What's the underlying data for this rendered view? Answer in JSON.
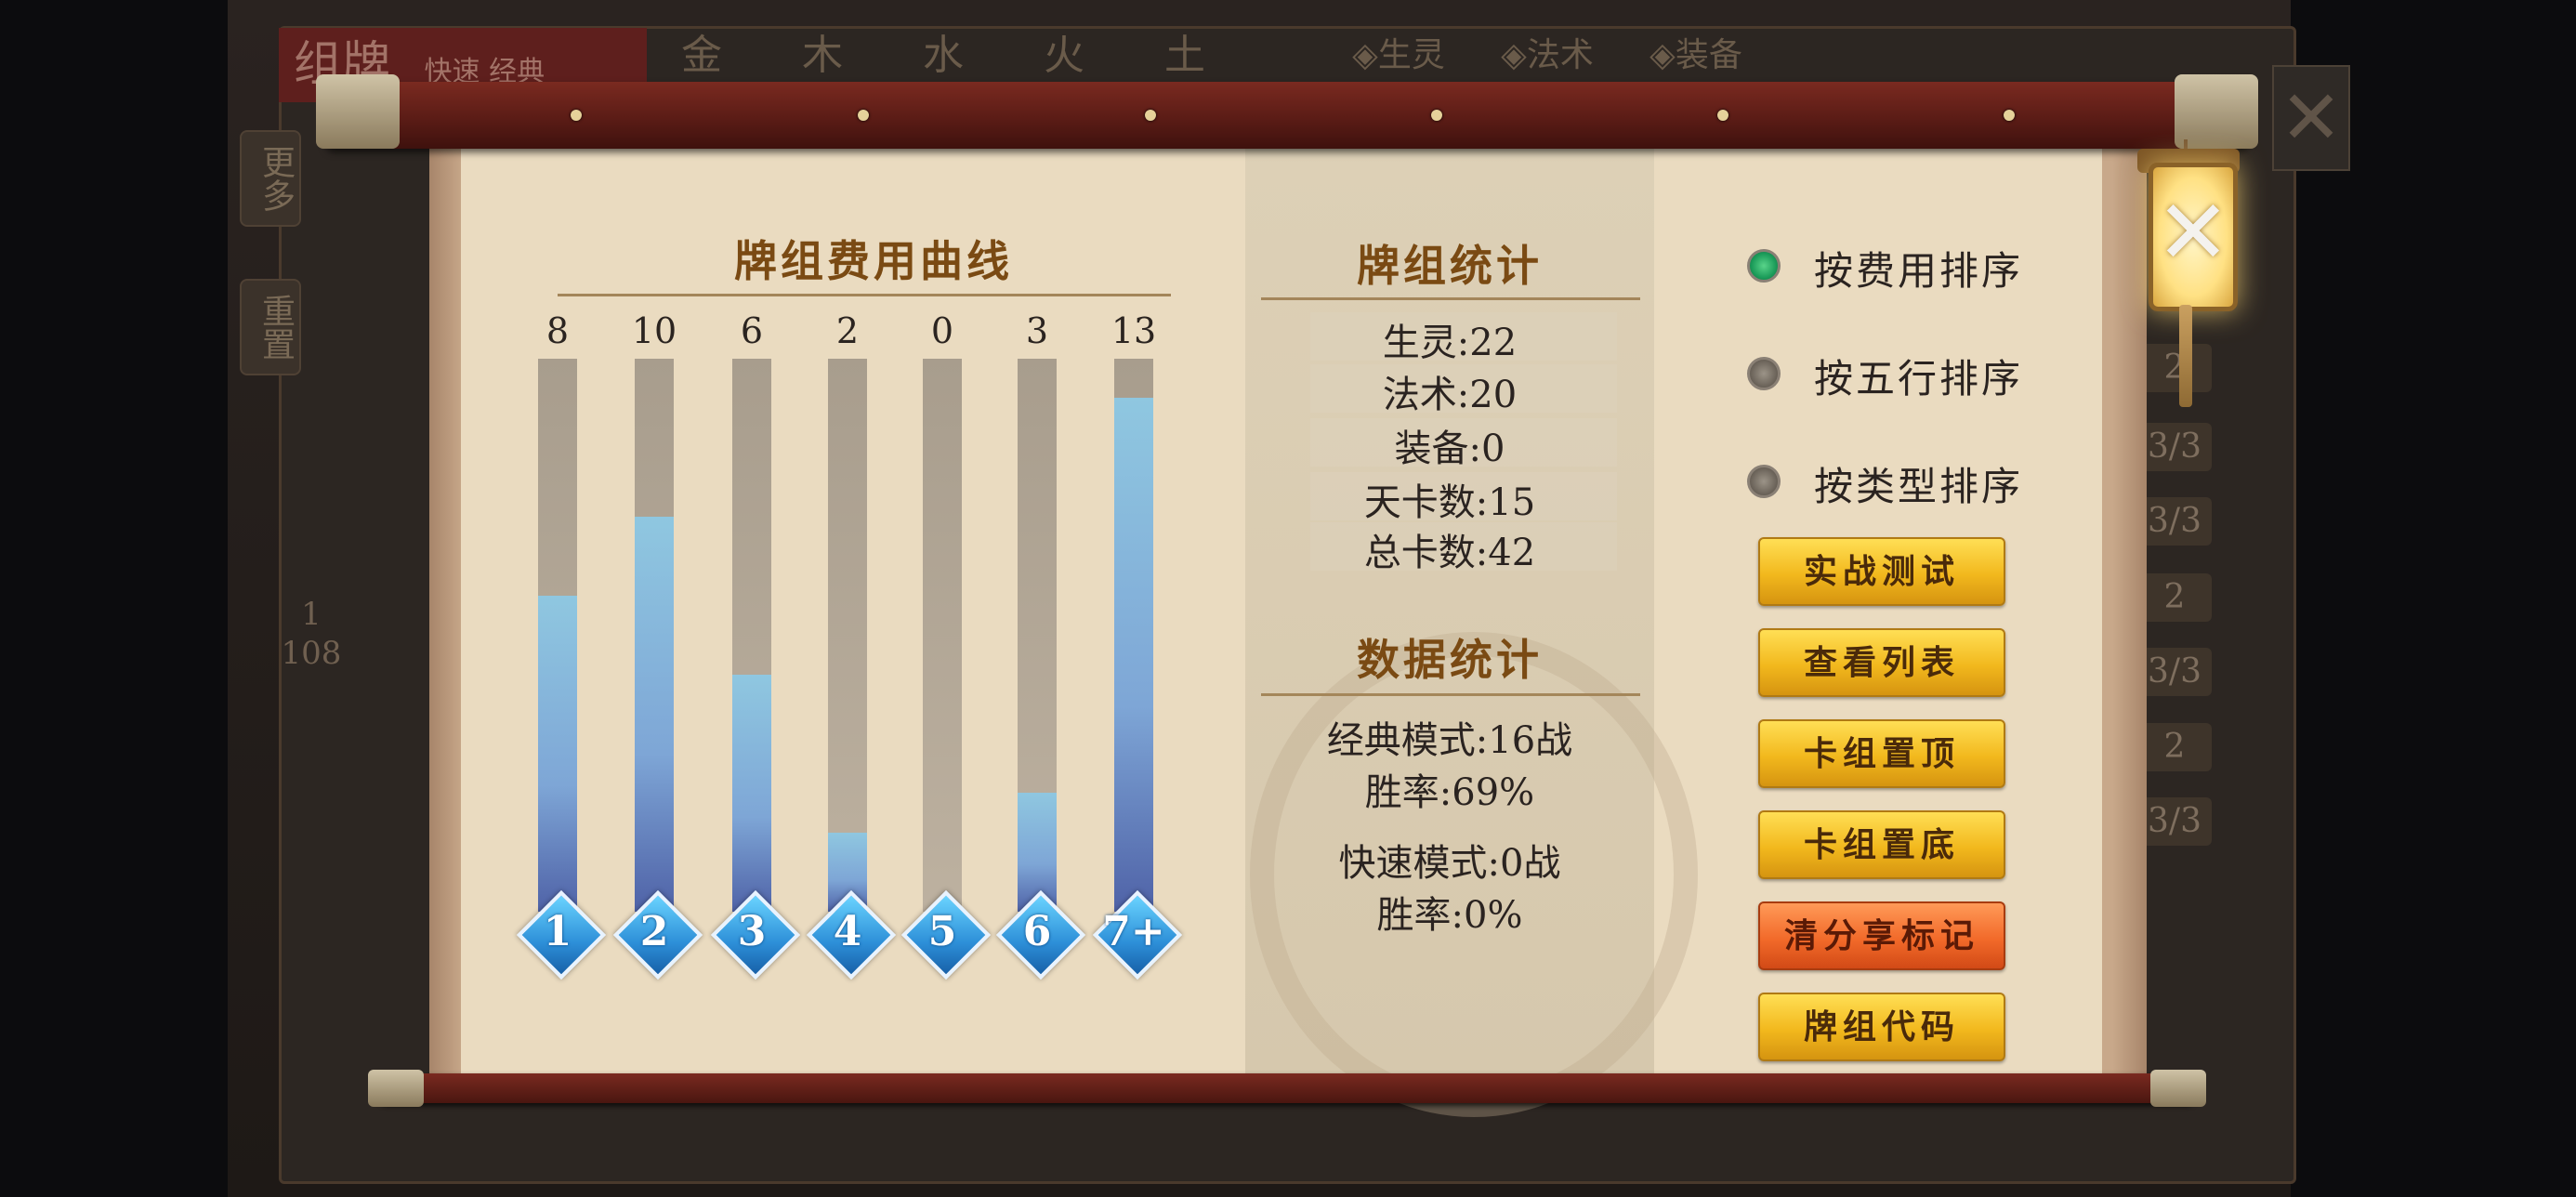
{
  "background": {
    "header_title": "组牌",
    "header_toggle": "快速 经典",
    "element_tabs": [
      "金",
      "木",
      "水",
      "火",
      "土"
    ],
    "filter_tabs": [
      "◈生灵",
      "◈法术",
      "◈装备"
    ],
    "side_buttons": [
      "更多",
      "重置"
    ],
    "page_counter": {
      "current": "1",
      "total": "108"
    },
    "right_counts": [
      "2",
      "3/3",
      "3/3",
      "2",
      "3/3",
      "2",
      "3/3"
    ]
  },
  "curve": {
    "title": "牌组费用曲线",
    "bars": [
      {
        "label": "1",
        "value": "8"
      },
      {
        "label": "2",
        "value": "10"
      },
      {
        "label": "3",
        "value": "6"
      },
      {
        "label": "4",
        "value": "2"
      },
      {
        "label": "5",
        "value": "0"
      },
      {
        "label": "6",
        "value": "3"
      },
      {
        "label": "7+",
        "value": "13"
      }
    ],
    "max": 14
  },
  "chart_data": {
    "type": "bar",
    "title": "牌组费用曲线",
    "categories": [
      "1",
      "2",
      "3",
      "4",
      "5",
      "6",
      "7+"
    ],
    "values": [
      8,
      10,
      6,
      2,
      0,
      3,
      13
    ],
    "xlabel": "",
    "ylabel": ""
  },
  "deck_stats": {
    "title": "牌组统计",
    "lines": [
      "生灵:22",
      "法术:20",
      "装备:0",
      "天卡数:15",
      "总卡数:42"
    ]
  },
  "data_stats": {
    "title": "数据统计",
    "classic_mode": "经典模式:16战",
    "classic_rate": "胜率:69%",
    "quick_mode": "快速模式:0战",
    "quick_rate": "胜率:0%"
  },
  "sort_options": [
    {
      "label": "按费用排序",
      "selected": true
    },
    {
      "label": "按五行排序",
      "selected": false
    },
    {
      "label": "按类型排序",
      "selected": false
    }
  ],
  "buttons": {
    "test": "实战测试",
    "list": "查看列表",
    "top": "卡组置顶",
    "bottom": "卡组置底",
    "clear_share": "清分享标记",
    "code": "牌组代码"
  },
  "colors": {
    "gold_button": "#f2b81d",
    "red_button": "#f26a2a",
    "title_brown": "#7a4a13",
    "bar_blue": "#7ea6d6",
    "selected_radio": "#1c9c5a"
  },
  "icons": {
    "close": "close-icon (lantern)",
    "sort_radio": "radio-dot",
    "cost_badge": "diamond-badge"
  }
}
